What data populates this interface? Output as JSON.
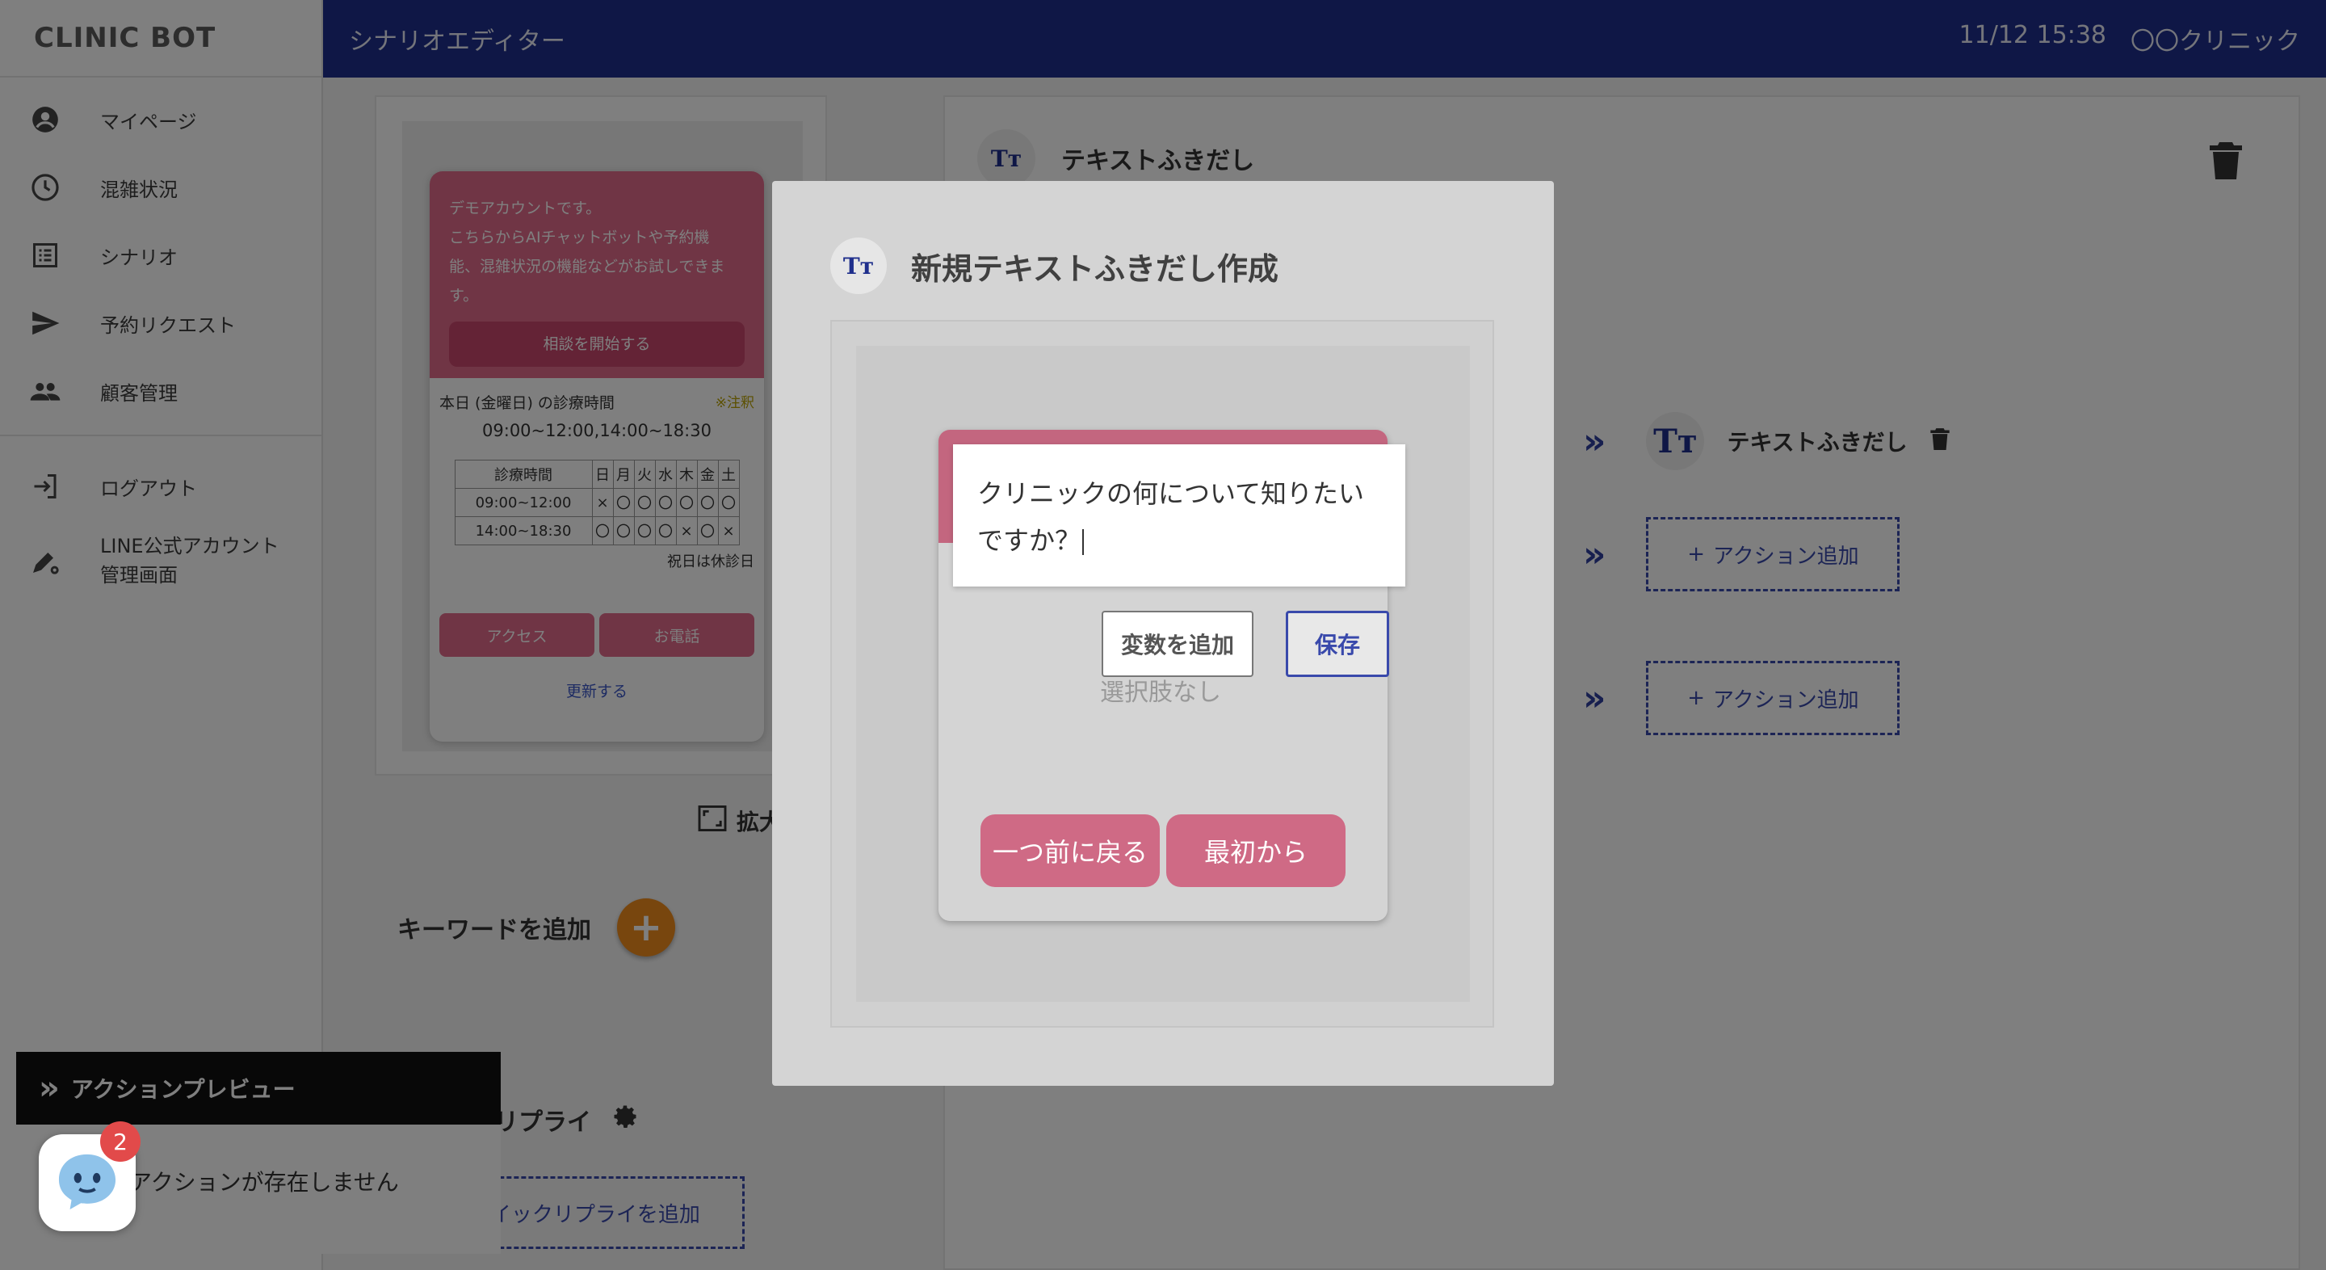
{
  "brand": "CLINIC BOT",
  "header": {
    "title": "シナリオエディター",
    "datetime": "11/12 15:38",
    "clinic": "〇〇クリニック"
  },
  "sidebar": {
    "items": [
      {
        "label": "マイページ",
        "icon": "account-circle-icon"
      },
      {
        "label": "混雑状況",
        "icon": "clock-icon"
      },
      {
        "label": "シナリオ",
        "icon": "list-icon"
      },
      {
        "label": "予約リクエスト",
        "icon": "send-icon"
      },
      {
        "label": "顧客管理",
        "icon": "people-icon"
      }
    ],
    "logout": "ログアウト",
    "line_admin_1": "LINE公式アカウント",
    "line_admin_2": "管理画面"
  },
  "preview": {
    "demo_line1": "デモアカウントです。",
    "demo_line2": "こちらからAIチャットボットや予約機",
    "demo_line3": "能、混雑状況の機能などがお試しできま",
    "demo_line4": "す。",
    "start_button": "相談を開始する",
    "today_label": "本日 (金曜日) の診療時間",
    "note": "※注釈",
    "today_hours": "09:00~12:00,14:00~18:30",
    "schedule_header": [
      "診療時間",
      "日",
      "月",
      "火",
      "水",
      "木",
      "金",
      "土"
    ],
    "schedule_rows": [
      [
        "09:00~12:00",
        "×",
        "〇",
        "〇",
        "〇",
        "〇",
        "〇",
        "〇"
      ],
      [
        "14:00~18:30",
        "〇",
        "〇",
        "〇",
        "〇",
        "×",
        "〇",
        "×"
      ]
    ],
    "holiday": "祝日は休診日",
    "access_button": "アクセス",
    "phone_button": "お電話",
    "update_link": "更新する"
  },
  "expand_label": "拡大",
  "keyword_label": "キーワードを追加",
  "quick_reply_label": "クイックリプライ",
  "add_quick_reply": "クイックリプライを追加",
  "right_panel": {
    "title": "テキストふきだし",
    "child_title": "テキストふきだし",
    "add_action_1": "アクション追加",
    "add_action_2": "アクション追加"
  },
  "action_preview": {
    "title": "アクションプレビュー",
    "empty": "アクションが存在しません"
  },
  "chat_badge": "2",
  "modal": {
    "title": "新規テキストふきだし作成",
    "ghost_text": "選択肢なし",
    "back_button": "一つ前に戻る",
    "restart_button": "最初から",
    "edit_line1": "クリニックの何について知りたい",
    "edit_line2": "ですか？",
    "add_variable": "変数を追加",
    "save": "保存"
  }
}
